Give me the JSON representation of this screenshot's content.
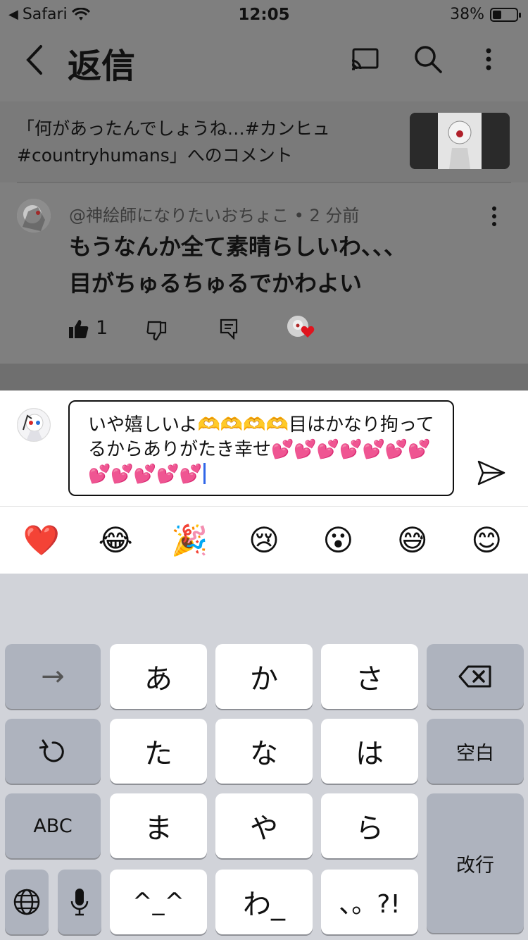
{
  "status_bar": {
    "back_app": "Safari",
    "time": "12:05",
    "battery_percent": "38%",
    "battery_level": 0.38
  },
  "header": {
    "title": "返信"
  },
  "context": {
    "text": "「何があったんでしょうね…#カンヒュ #countryhumans」へのコメント"
  },
  "comment": {
    "author": "@神絵師になりたいおちょこ",
    "time": "2 分前",
    "text_line1": "もうなんか全て素晴らしいわ、、、",
    "text_line2": "目がちゅるちゅるでかわよい",
    "like_count": "1"
  },
  "composer": {
    "text": "いや嬉しいよ🫶🫶🫶🫶目はかなり拘ってるからありがたき幸せ💕💕💕💕💕💕💕💕💕💕💕💕"
  },
  "quick_emojis": [
    "❤️",
    "😂",
    "🎉",
    "😢",
    "😮",
    "😅",
    "😊"
  ],
  "keyboard": {
    "row1": [
      "→",
      "あ",
      "か",
      "さ"
    ],
    "row2": [
      "た",
      "な",
      "は",
      "空白"
    ],
    "row3": [
      "ABC",
      "ま",
      "や",
      "ら",
      "改行"
    ],
    "row4": [
      "^_^",
      "わ_",
      "、。?!"
    ]
  }
}
